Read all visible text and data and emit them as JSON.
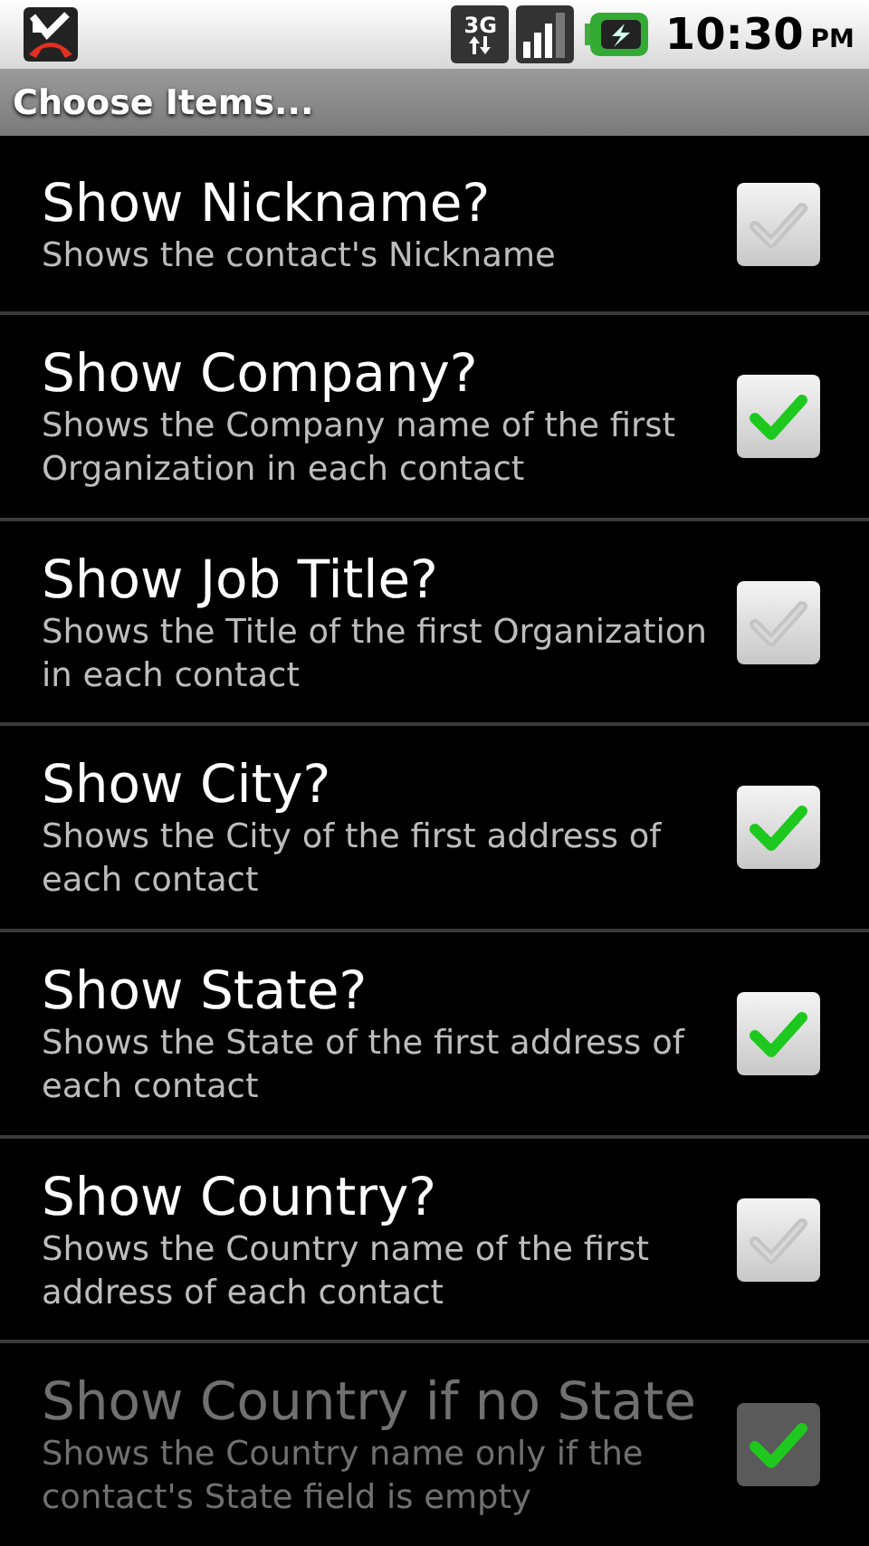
{
  "status_bar": {
    "network": "3G",
    "time": "10:30",
    "ampm": "PM"
  },
  "title": "Choose Items...",
  "items": [
    {
      "title": "Show Nickname?",
      "summary": "Shows the contact's Nickname",
      "checked": false,
      "disabled": false
    },
    {
      "title": "Show Company?",
      "summary": "Shows the Company name of the first Organization in each contact",
      "checked": true,
      "disabled": false
    },
    {
      "title": "Show Job Title?",
      "summary": "Shows the Title of the first Organization in each contact",
      "checked": false,
      "disabled": false
    },
    {
      "title": "Show City?",
      "summary": "Shows the City of the first address of each contact",
      "checked": true,
      "disabled": false
    },
    {
      "title": "Show State?",
      "summary": "Shows the State of the first address of each contact",
      "checked": true,
      "disabled": false
    },
    {
      "title": "Show Country?",
      "summary": "Shows the Country name of the first address of each contact",
      "checked": false,
      "disabled": false
    },
    {
      "title": "Show Country if no State",
      "summary": "Shows the Country name only if the contact's State field is empty",
      "checked": true,
      "disabled": true
    }
  ]
}
